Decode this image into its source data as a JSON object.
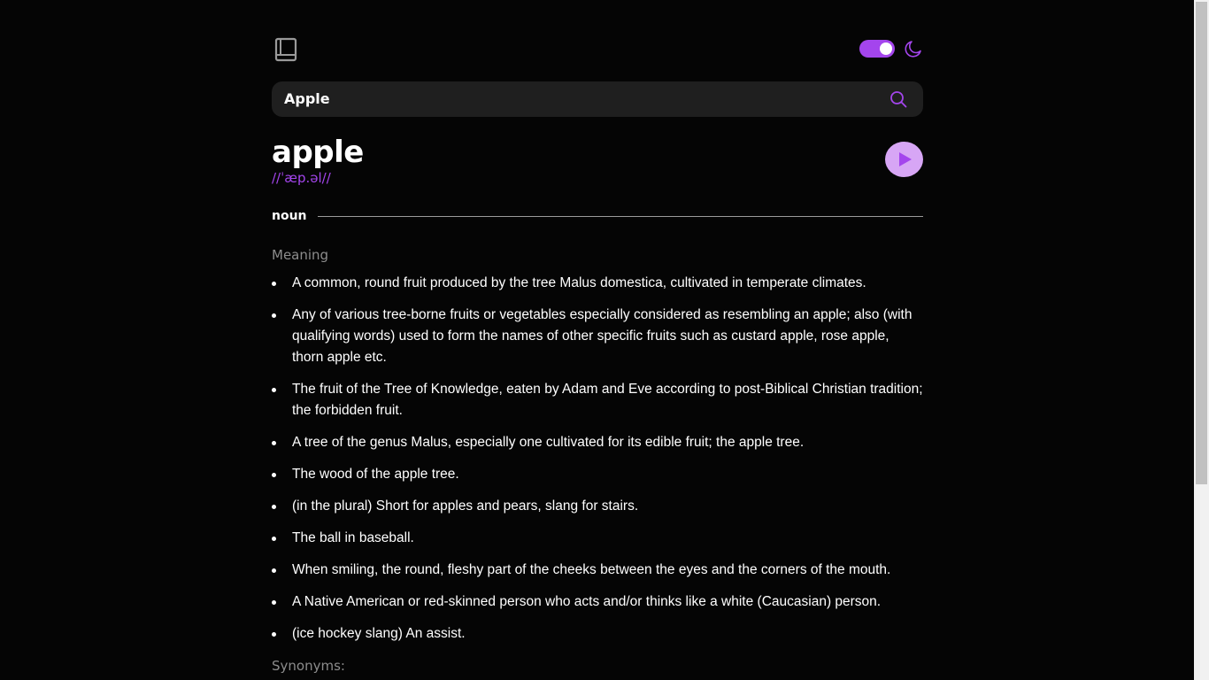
{
  "header": {
    "logo_icon": "book-icon",
    "theme_toggle": {
      "state": "on",
      "accent": "#a445ed"
    },
    "theme_icon": "moon-icon"
  },
  "search": {
    "value": "Apple",
    "placeholder": "",
    "icon": "search-icon"
  },
  "entry": {
    "word": "apple",
    "phonetic": "//ˈæp.əl//",
    "play_icon": "play-icon",
    "part_of_speech": "noun",
    "meaning_label": "Meaning",
    "definitions": [
      "A common, round fruit produced by the tree Malus domestica, cultivated in temperate climates.",
      "Any of various tree-borne fruits or vegetables especially considered as resembling an apple; also (with qualifying words) used to form the names of other specific fruits such as custard apple, rose apple, thorn apple etc.",
      "The fruit of the Tree of Knowledge, eaten by Adam and Eve according to post-Biblical Christian tradition; the forbidden fruit.",
      "A tree of the genus Malus, especially one cultivated for its edible fruit; the apple tree.",
      "The wood of the apple tree.",
      "(in the plural) Short for apples and pears, slang for stairs.",
      "The ball in baseball.",
      "When smiling, the round, fleshy part of the cheeks between the eyes and the corners of the mouth.",
      "A Native American or red-skinned person who acts and/or thinks like a white (Caucasian) person.",
      "(ice hockey slang) An assist."
    ],
    "synonyms_label": "Synonyms:"
  },
  "colors": {
    "background": "#050505",
    "accent": "#a445ed",
    "play_button": "#d7a6f5",
    "muted_text": "#8c8c8c",
    "search_bg": "#1f1f1f"
  }
}
